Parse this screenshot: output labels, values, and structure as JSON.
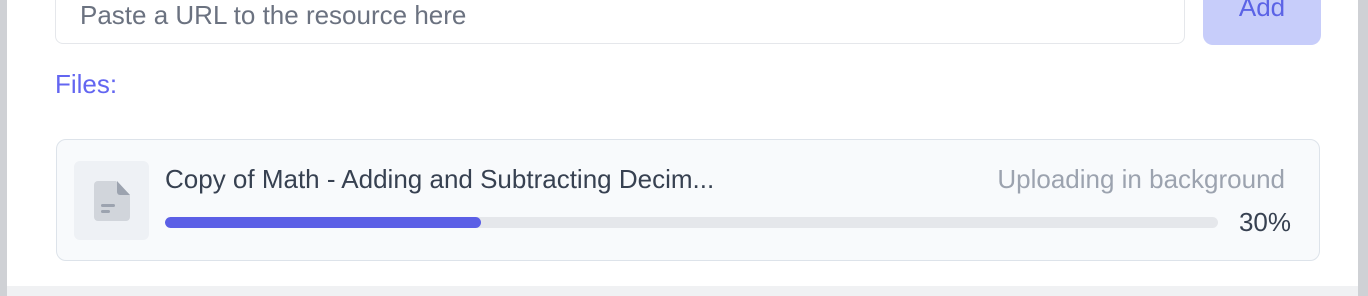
{
  "url_field": {
    "placeholder": "Paste a URL to the resource here",
    "value": ""
  },
  "add_button": {
    "label": "Add"
  },
  "files_label": "Files:",
  "file": {
    "name": "Copy of Math - Adding and Subtracting Decim...",
    "status": "Uploading in background",
    "progress_percent_text": "30%",
    "progress_fraction": 0.3,
    "icon": "file-document-icon"
  },
  "colors": {
    "accent": "#6366f1",
    "progress_fill": "#5b5fe6",
    "add_button_bg": "#c7cdfa"
  }
}
